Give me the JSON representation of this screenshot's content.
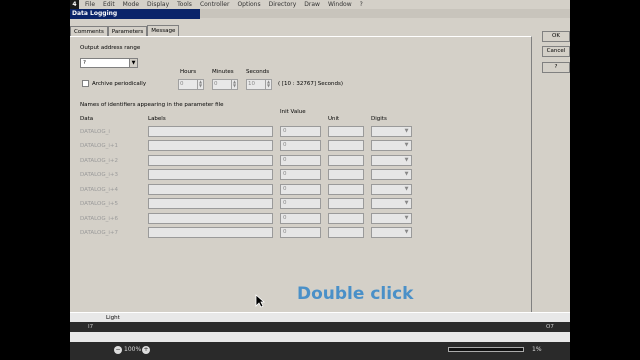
{
  "menubar": {
    "logo": "4",
    "items": [
      "File",
      "Edit",
      "Mode",
      "Display",
      "Tools",
      "Controller",
      "Options",
      "Directory",
      "Draw",
      "Window",
      "?"
    ],
    "close": "×"
  },
  "dialog": {
    "title": "Data Logging",
    "tabs": [
      "Comments",
      "Parameters",
      "Message"
    ],
    "output_range_label": "Output address range",
    "output_range_value": "?",
    "archive_label": "Archive periodically",
    "hours_label": "Hours",
    "minutes_label": "Minutes",
    "seconds_label": "Seconds",
    "hours_value": "0",
    "minutes_value": "0",
    "seconds_value": "10",
    "range_hint": "( [10 : 32767] Seconds)",
    "names_label": "Names of identifiers appearing in the parameter file",
    "col_data": "Data",
    "col_labels": "Labels",
    "col_init": "Init Value",
    "col_unit": "Unit",
    "col_digits": "Digits",
    "rows": [
      {
        "data": "DATALOG_i",
        "init": "0"
      },
      {
        "data": "DATALOG_i+1",
        "init": "0"
      },
      {
        "data": "DATALOG_i+2",
        "init": "0"
      },
      {
        "data": "DATALOG_i+3",
        "init": "0"
      },
      {
        "data": "DATALOG_i+4",
        "init": "0"
      },
      {
        "data": "DATALOG_i+5",
        "init": "0"
      },
      {
        "data": "DATALOG_i+6",
        "init": "0"
      },
      {
        "data": "DATALOG_i+7",
        "init": "0"
      }
    ],
    "buttons": {
      "ok": "OK",
      "cancel": "Cancel",
      "help": "?"
    }
  },
  "bottom": {
    "light_label": "Light",
    "left_marker": "I7",
    "right_marker": "O7"
  },
  "status": {
    "zoom": "100%",
    "percent": "1%"
  },
  "overlay_text": "Double click"
}
